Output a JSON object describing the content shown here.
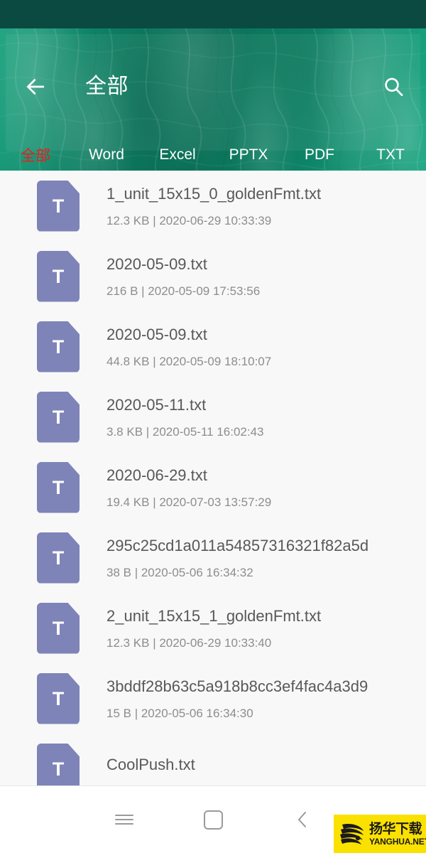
{
  "statusbar": {
    "color": "#0b4a41"
  },
  "header": {
    "title": "全部",
    "back_icon": "arrow-left-icon",
    "search_icon": "search-icon",
    "background_color": "#0f8066",
    "texture": "topographic-contour-lines"
  },
  "tabs": {
    "active_index": 0,
    "active_color": "#f01b1b",
    "indicator_color": "#e01e52",
    "items": [
      {
        "label": "全部"
      },
      {
        "label": "Word"
      },
      {
        "label": "Excel"
      },
      {
        "label": "PPTX"
      },
      {
        "label": "PDF"
      },
      {
        "label": "TXT"
      }
    ]
  },
  "file_list": {
    "icon_color": "#7e84b8",
    "icon_glyph": "T",
    "background_color": "#f8f8f8",
    "items": [
      {
        "name": "1_unit_15x15_0_goldenFmt.txt",
        "meta": "12.3 KB | 2020-06-29 10:33:39",
        "size": "12.3 KB",
        "date": "2020-06-29 10:33:39"
      },
      {
        "name": "2020-05-09.txt",
        "meta": "216 B | 2020-05-09 17:53:56",
        "size": "216 B",
        "date": "2020-05-09 17:53:56"
      },
      {
        "name": "2020-05-09.txt",
        "meta": "44.8 KB | 2020-05-09 18:10:07",
        "size": "44.8 KB",
        "date": "2020-05-09 18:10:07"
      },
      {
        "name": "2020-05-11.txt",
        "meta": "3.8 KB | 2020-05-11 16:02:43",
        "size": "3.8 KB",
        "date": "2020-05-11 16:02:43"
      },
      {
        "name": "2020-06-29.txt",
        "meta": "19.4 KB | 2020-07-03 13:57:29",
        "size": "19.4 KB",
        "date": "2020-07-03 13:57:29"
      },
      {
        "name": "295c25cd1a011a54857316321f82a5d",
        "meta": "38 B | 2020-05-06 16:34:32",
        "size": "38 B",
        "date": "2020-05-06 16:34:32"
      },
      {
        "name": "2_unit_15x15_1_goldenFmt.txt",
        "meta": "12.3 KB | 2020-06-29 10:33:40",
        "size": "12.3 KB",
        "date": "2020-06-29 10:33:40"
      },
      {
        "name": "3bddf28b63c5a918b8cc3ef4fac4a3d9",
        "meta": "15 B | 2020-05-06 16:34:30",
        "size": "15 B",
        "date": "2020-05-06 16:34:30"
      },
      {
        "name": "CoolPush.txt",
        "meta": "",
        "size": "",
        "date": ""
      }
    ]
  },
  "navbar": {
    "recent_icon": "hamburger-menu-icon",
    "home_icon": "rounded-square-home-icon",
    "back_icon": "chevron-left-icon"
  },
  "watermark": {
    "cn_text": "扬华下载",
    "en_text": "YANGHUA.NET",
    "background_color": "#fbe100"
  }
}
